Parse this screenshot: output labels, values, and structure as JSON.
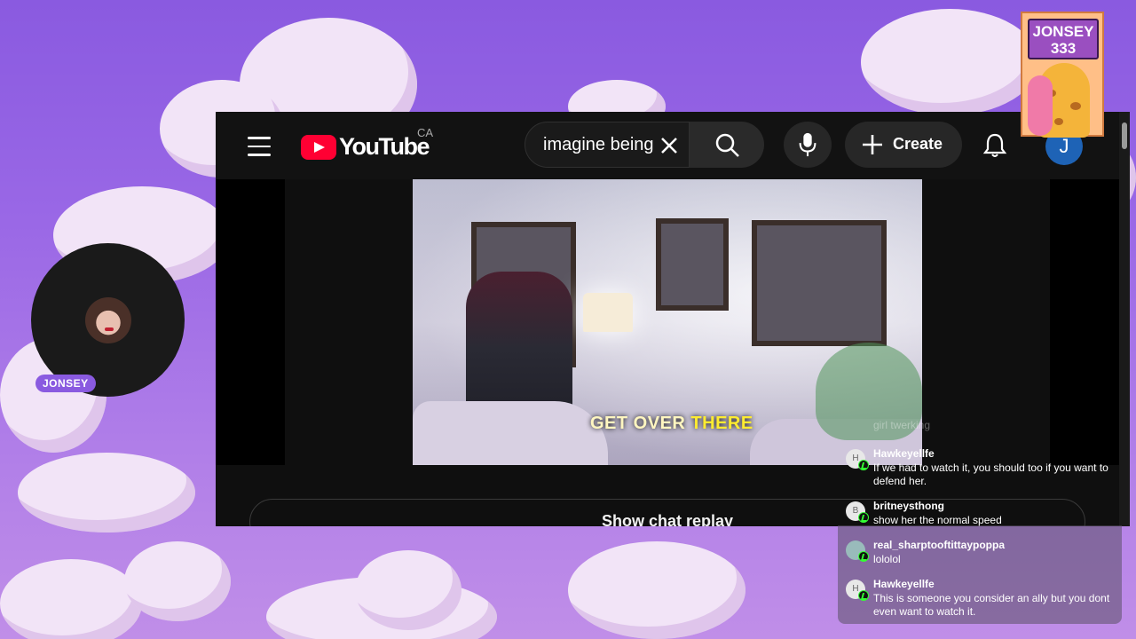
{
  "youtube": {
    "logo_text": "YouTube",
    "country_code": "CA",
    "search_value": "imagine being",
    "create_label": "Create",
    "avatar_letter": "J",
    "video_caption_part1": "GET OVER ",
    "video_caption_part2": "THERE",
    "show_chat_label": "Show chat replay"
  },
  "streamer": {
    "name_tag": "JONSEY",
    "sticker_line1": "JONSEY",
    "sticker_line2": "333"
  },
  "chat": {
    "faint_text": "girl twerking",
    "messages": [
      {
        "user": "Hawkeyellfe",
        "initial": "H",
        "text": "If we had to watch it, you should too if you want to defend her."
      },
      {
        "user": "britneysthong",
        "initial": "B",
        "text": "show her the normal speed"
      },
      {
        "user": "real_sharptooftittaypoppa",
        "initial": "",
        "text": "lololol"
      },
      {
        "user": "Hawkeyellfe",
        "initial": "H",
        "text": "This is someone you consider an ally but you dont even want to watch it."
      }
    ]
  },
  "colors": {
    "background": "#8a5ae0",
    "youtube_red": "#ff0033",
    "chat_badge": "#33ff33",
    "name_pill": "#8a5ae0"
  },
  "icons": [
    "menu-icon",
    "youtube-logo-icon",
    "clear-icon",
    "search-icon",
    "mic-icon",
    "plus-icon",
    "bell-icon"
  ]
}
